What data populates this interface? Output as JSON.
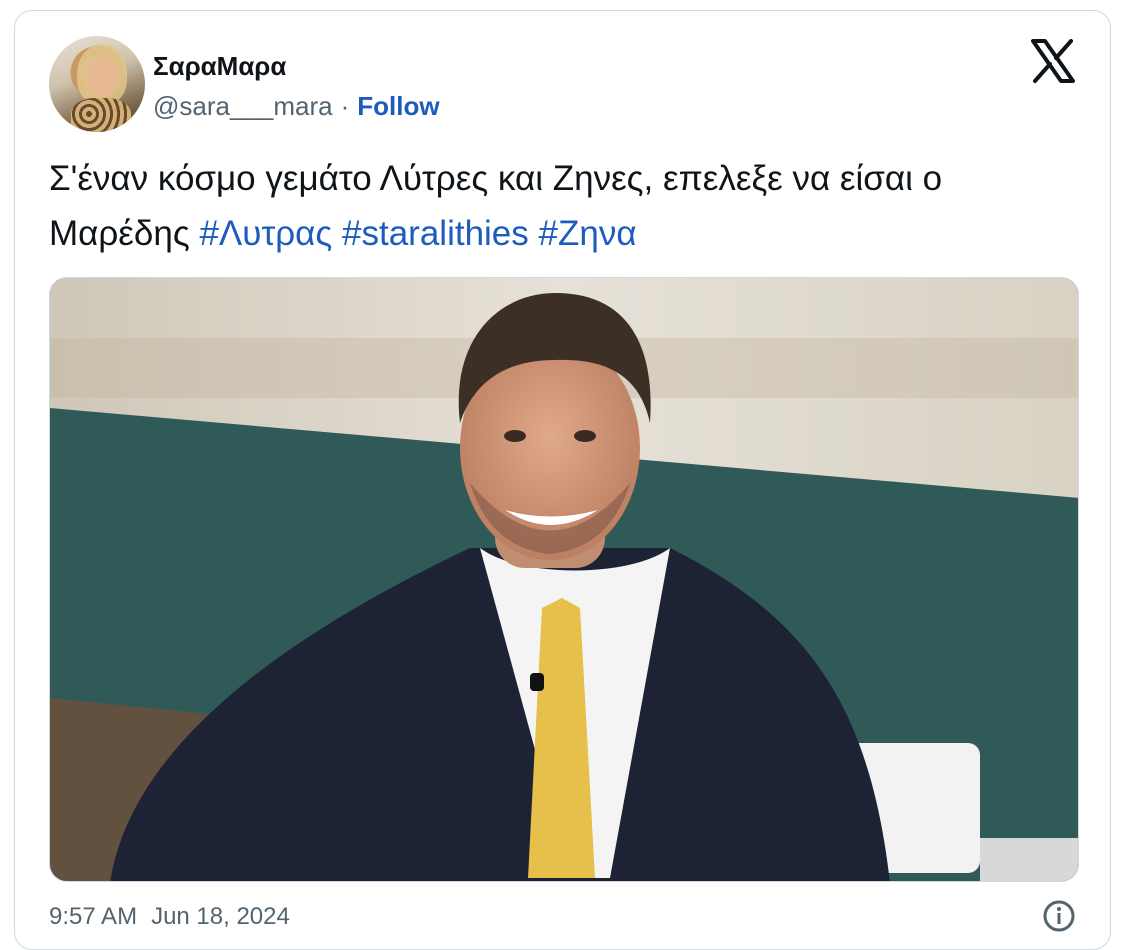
{
  "user": {
    "display_name": "ΣαραΜαρα",
    "handle": "@sara___mara",
    "separator": "·",
    "follow_label": "Follow"
  },
  "tweet": {
    "text_before": "Σ'έναν κόσμο γεμάτο Λύτρες και Ζηνες, επελεξε να είσαι ο Μαρέδης",
    "hashtags": [
      "#Λυτρας",
      "#staralithies",
      "#Ζηνα"
    ]
  },
  "footer": {
    "time": "9:57 AM",
    "date": "Jun 18, 2024"
  },
  "icons": {
    "brand": "x-logo-icon",
    "info": "info-icon"
  },
  "colors": {
    "link": "#1d5bbf",
    "text": "#0f1419",
    "muted": "#536471",
    "border": "#cfd9de"
  }
}
